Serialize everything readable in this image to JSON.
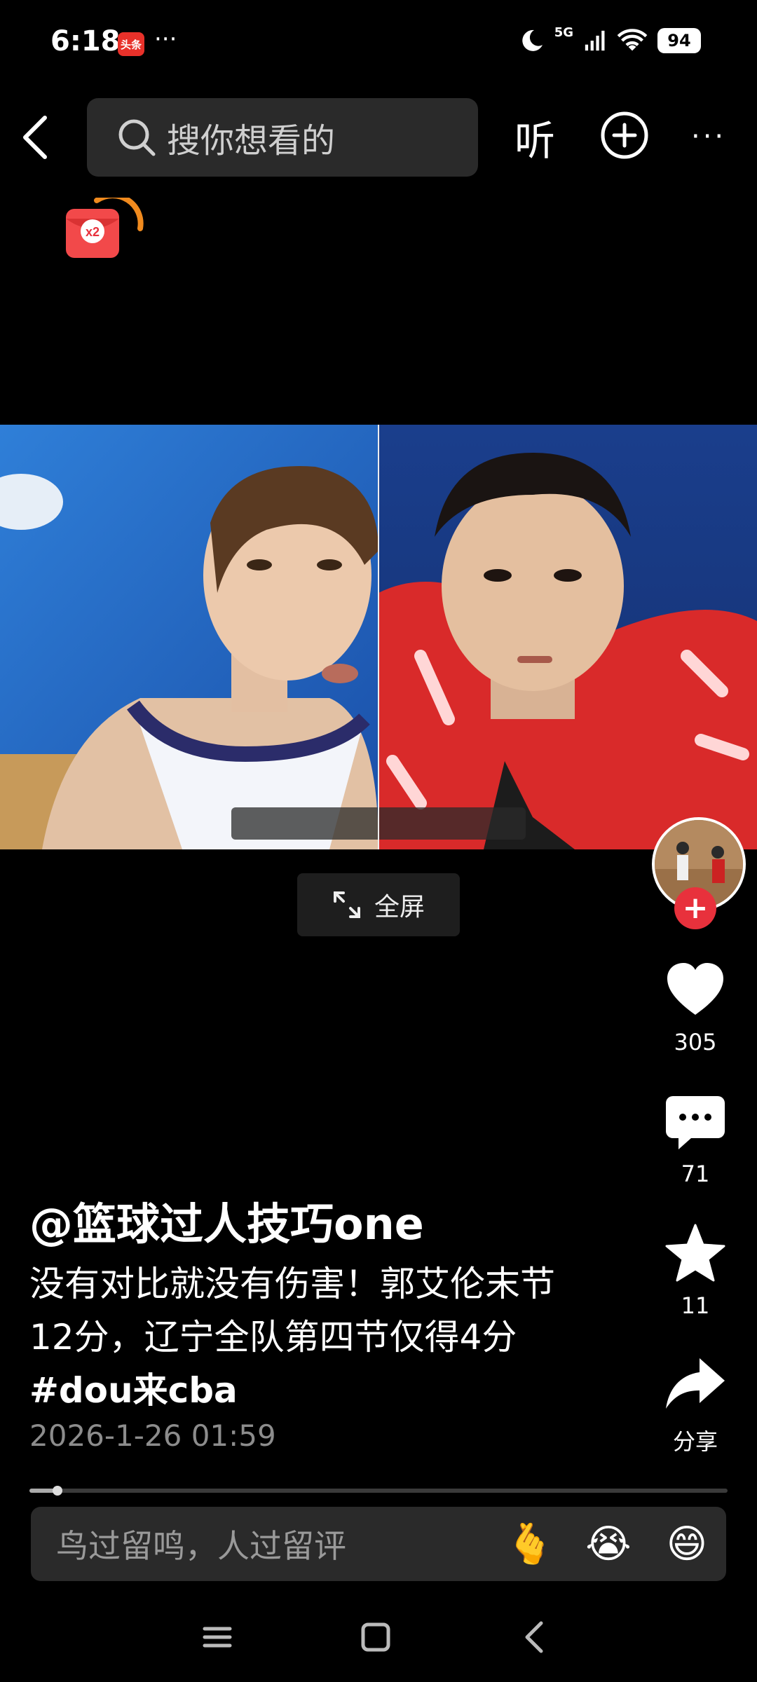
{
  "status_bar": {
    "time": "6:18",
    "app_badge": "头条",
    "dots": "···",
    "network": "5G",
    "battery": "94"
  },
  "top_nav": {
    "search_placeholder": "搜你想看的",
    "listen_label": "听",
    "more_label": "···"
  },
  "envelope": {
    "multiplier": "x2"
  },
  "video": {
    "fullscreen_label": "全屏"
  },
  "actions": {
    "like_count": "305",
    "comment_count": "71",
    "favorite_count": "11",
    "share_label": "分享"
  },
  "post": {
    "author": "@篮球过人技巧one",
    "caption_text": "没有对比就没有伤害！郭艾伦末节12分，辽宁全队第四节仅得4分 ",
    "caption_tag": "#dou来cba",
    "timestamp": "2026-1-26 01:59"
  },
  "playback": {
    "progress_fraction": 0.04
  },
  "comment_bar": {
    "placeholder": "鸟过留鸣，人过留评",
    "emojis": [
      "🫰",
      "😭",
      "😄"
    ]
  },
  "colors": {
    "accent_red": "#e8313c",
    "background": "#000000",
    "surface": "#2a2a2a"
  }
}
